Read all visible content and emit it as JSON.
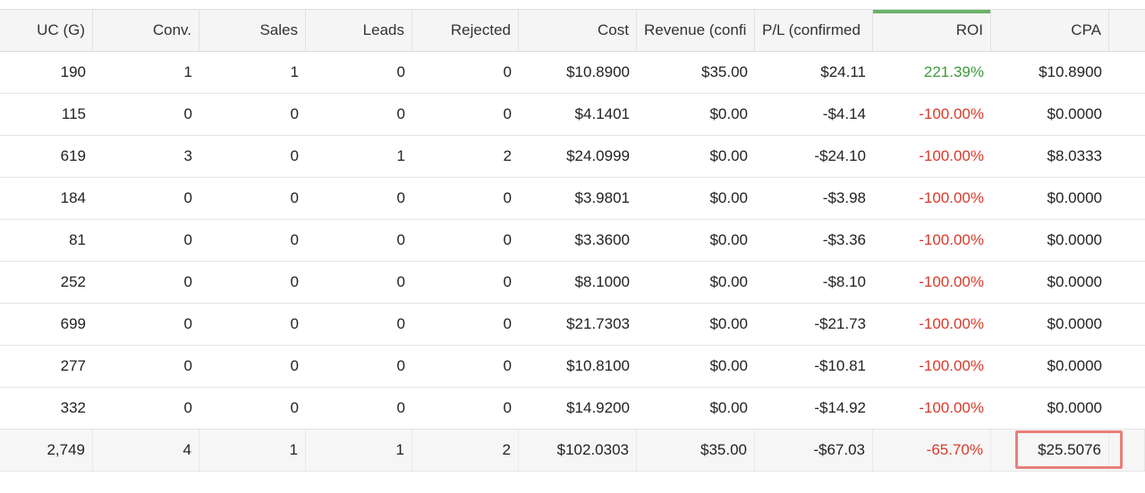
{
  "columns": [
    "UC (G)",
    "Conv.",
    "Sales",
    "Leads",
    "Rejected",
    "Cost",
    "Revenue (confi",
    "P/L (confirmed",
    "ROI",
    "CPA"
  ],
  "rows": [
    [
      "190",
      "1",
      "1",
      "0",
      "0",
      "$10.8900",
      "$35.00",
      "$24.11",
      "221.39%",
      "$10.8900"
    ],
    [
      "115",
      "0",
      "0",
      "0",
      "0",
      "$4.1401",
      "$0.00",
      "-$4.14",
      "-100.00%",
      "$0.0000"
    ],
    [
      "619",
      "3",
      "0",
      "1",
      "2",
      "$24.0999",
      "$0.00",
      "-$24.10",
      "-100.00%",
      "$8.0333"
    ],
    [
      "184",
      "0",
      "0",
      "0",
      "0",
      "$3.9801",
      "$0.00",
      "-$3.98",
      "-100.00%",
      "$0.0000"
    ],
    [
      "81",
      "0",
      "0",
      "0",
      "0",
      "$3.3600",
      "$0.00",
      "-$3.36",
      "-100.00%",
      "$0.0000"
    ],
    [
      "252",
      "0",
      "0",
      "0",
      "0",
      "$8.1000",
      "$0.00",
      "-$8.10",
      "-100.00%",
      "$0.0000"
    ],
    [
      "699",
      "0",
      "0",
      "0",
      "0",
      "$21.7303",
      "$0.00",
      "-$21.73",
      "-100.00%",
      "$0.0000"
    ],
    [
      "277",
      "0",
      "0",
      "0",
      "0",
      "$10.8100",
      "$0.00",
      "-$10.81",
      "-100.00%",
      "$0.0000"
    ],
    [
      "332",
      "0",
      "0",
      "0",
      "0",
      "$14.9200",
      "$0.00",
      "-$14.92",
      "-100.00%",
      "$0.0000"
    ]
  ],
  "total": [
    "2,749",
    "4",
    "1",
    "1",
    "2",
    "$102.0303",
    "$35.00",
    "-$67.03",
    "-65.70%",
    "$25.5076"
  ],
  "colors": {
    "positive": "#3c9a3c",
    "negative": "#d93a2b",
    "active_sort": "#6ab26a",
    "highlight": "#e8807a"
  }
}
